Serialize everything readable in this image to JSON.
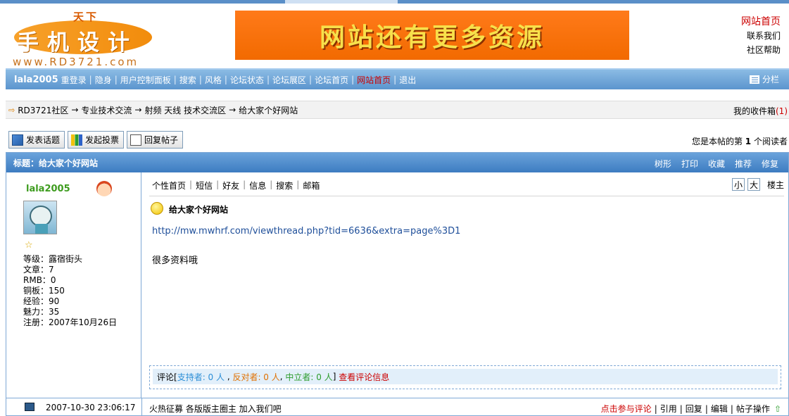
{
  "header": {
    "logo": {
      "tianxia": "天下",
      "brand": "手机设计",
      "url": "www.RD3721.com"
    },
    "banner_text": "网站还有更多资源",
    "links": {
      "home": "网站首页",
      "contact": "联系我们",
      "help": "社区帮助"
    }
  },
  "nav": {
    "user": "lala2005",
    "items": [
      "重登录",
      "隐身",
      "用户控制面板",
      "搜索",
      "风格",
      "论坛状态",
      "论坛展区",
      "论坛首页",
      "网站首页",
      "退出"
    ],
    "right_label": "分栏"
  },
  "breadcrumb": {
    "items": [
      "RD3721社区",
      "专业技术交流",
      "射频 天线 技术交流区",
      "给大家个好网站"
    ],
    "arrow": "→",
    "inbox_label": "我的收件箱",
    "inbox_count": "(1)"
  },
  "actions": {
    "new_topic": "发表话题",
    "new_poll": "发起投票",
    "reply": "回复帖子",
    "readers_prefix": "您是本帖的第",
    "readers_count": "1",
    "readers_suffix": "个阅读者"
  },
  "post": {
    "title_label": "标题：",
    "title": "给大家个好网站",
    "tools": [
      "树形",
      "打印",
      "收藏",
      "推荐",
      "修复"
    ],
    "author": {
      "name": "lala2005",
      "stats": [
        "等级：露宿街头",
        "文章：7",
        "RMB：0",
        "铜板：150",
        "经验：90",
        "魅力：35",
        "注册：2007年10月26日"
      ]
    },
    "user_links": [
      "个性首页",
      "短信",
      "好友",
      "信息",
      "搜索",
      "邮箱"
    ],
    "font_small": "小",
    "font_large": "大",
    "floor": "楼主",
    "subject": "给大家个好网站",
    "link": "http://mw.mwhrf.com/viewthread.php?tid=6636&extra=page%3D1",
    "message": "很多资料哦",
    "comment": {
      "prefix": "评论[",
      "support": "支持者: 0 人",
      "oppose": "反对者: 0 人",
      "neutral": "中立者: 0 人",
      "suffix": "]",
      "view": "查看评论信息"
    },
    "footer": {
      "date": "2007-10-30 23:06:17",
      "recruit": "火热征募 各版版主圈主 加入我们吧",
      "ops": [
        "点击参与评论",
        "引用",
        "回复",
        "编辑",
        "帖子操作"
      ]
    }
  }
}
